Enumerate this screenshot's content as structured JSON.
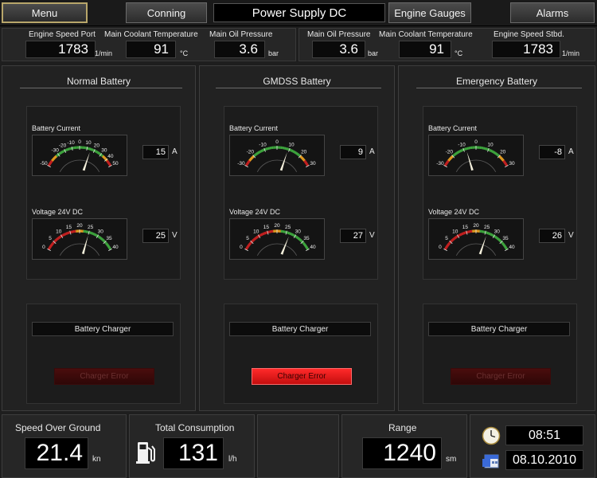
{
  "nav": {
    "menu": "Menu",
    "conning": "Conning",
    "title": "Power Supply DC",
    "engine_gauges": "Engine Gauges",
    "alarms": "Alarms"
  },
  "engine_port": {
    "speed_label": "Engine Speed Port",
    "speed_value": "1783",
    "speed_unit": "1/min",
    "coolant_label": "Main Coolant Temperature",
    "coolant_value": "91",
    "coolant_unit": "°C",
    "oil_label": "Main Oil Pressure",
    "oil_value": "3.6",
    "oil_unit": "bar"
  },
  "engine_stbd": {
    "oil_label": "Main Oil Pressure",
    "oil_value": "3.6",
    "oil_unit": "bar",
    "coolant_label": "Main Coolant Temperature",
    "coolant_value": "91",
    "coolant_unit": "°C",
    "speed_label": "Engine Speed Stbd.",
    "speed_value": "1783",
    "speed_unit": "1/min"
  },
  "batteries": [
    {
      "title": "Normal Battery",
      "current_label": "Battery Current",
      "current_value": 15,
      "current_unit": "A",
      "current_ticks": [
        "-50",
        "-30",
        "-20",
        "-10",
        "0",
        "10",
        "20",
        "30",
        "40",
        "50"
      ],
      "voltage_label": "Voltage 24V DC",
      "voltage_value": 25,
      "voltage_unit": "V",
      "voltage_ticks": [
        "0",
        "5",
        "10",
        "15",
        "20",
        "25",
        "30",
        "35",
        "40"
      ],
      "charger_label": "Battery Charger",
      "charger_error_label": "Charger Error",
      "charger_error_active": false
    },
    {
      "title": "GMDSS Battery",
      "current_label": "Battery Current",
      "current_value": 9,
      "current_unit": "A",
      "current_ticks": [
        "-30",
        "-20",
        "-10",
        "0",
        "10",
        "20",
        "30"
      ],
      "voltage_label": "Voltage 24V DC",
      "voltage_value": 27,
      "voltage_unit": "V",
      "voltage_ticks": [
        "0",
        "5",
        "10",
        "15",
        "20",
        "25",
        "30",
        "35",
        "40"
      ],
      "charger_label": "Battery Charger",
      "charger_error_label": "Charger Error",
      "charger_error_active": true
    },
    {
      "title": "Emergency Battery",
      "current_label": "Battery Current",
      "current_value": -8,
      "current_unit": "A",
      "current_ticks": [
        "-30",
        "-20",
        "-10",
        "0",
        "10",
        "20",
        "30"
      ],
      "voltage_label": "Voltage 24V DC",
      "voltage_value": 26,
      "voltage_unit": "V",
      "voltage_ticks": [
        "0",
        "5",
        "10",
        "15",
        "20",
        "25",
        "30",
        "35",
        "40"
      ],
      "charger_label": "Battery Charger",
      "charger_error_label": "Charger Error",
      "charger_error_active": false
    }
  ],
  "bottom": {
    "sog_label": "Speed Over Ground",
    "sog_value": "21.4",
    "sog_unit": "kn",
    "consumption_label": "Total Consumption",
    "consumption_value": "131",
    "consumption_unit": "l/h",
    "range_label": "Range",
    "range_value": "1240",
    "range_unit": "sm",
    "time": "08:51",
    "date": "08.10.2010"
  },
  "colors": {
    "accent_border": "#b8a66a",
    "charger_error_active": "#ff2020",
    "charger_error_inactive": "#4a0d0d",
    "gauge_red": "#c82020",
    "gauge_orange": "#e8a020",
    "gauge_green": "#3ea83e"
  },
  "icons": {
    "clock": "clock-icon",
    "calendar": "calendar-icon",
    "fuel": "fuel-pump-icon"
  }
}
